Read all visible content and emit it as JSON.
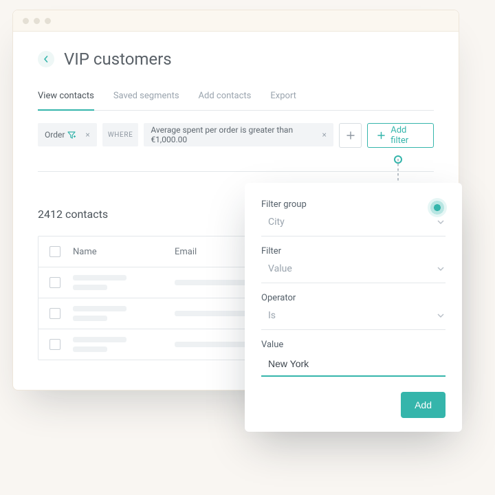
{
  "page": {
    "title": "VIP customers"
  },
  "tabs": {
    "active": "View contacts",
    "items": [
      "View contacts",
      "Saved segments",
      "Add contacts",
      "Export"
    ]
  },
  "filterbar": {
    "source_chip": "Order",
    "where_label": "WHERE",
    "condition": "Average spent per order  is greater than  €1,000.00",
    "add_filter_label": "Add filter"
  },
  "contacts": {
    "count_label": "2412 contacts",
    "columns": {
      "name": "Name",
      "email": "Email"
    },
    "rows": 3
  },
  "popover": {
    "fields": {
      "group": {
        "label": "Filter group",
        "value": "City"
      },
      "filter": {
        "label": "Filter",
        "value": "Value"
      },
      "operator": {
        "label": "Operator",
        "value": "Is"
      },
      "value": {
        "label": "Value",
        "input": "New York"
      }
    },
    "add_label": "Add"
  }
}
